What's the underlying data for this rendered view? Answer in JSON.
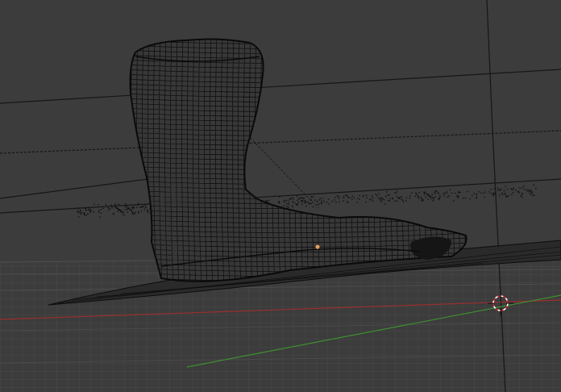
{
  "viewport": {
    "mode": "wireframe",
    "background_color": "#3c3c3c",
    "grid_color": "#4a4a4a",
    "x_axis_color": "#9b2f2f",
    "y_axis_color": "#3f8f2f",
    "wire_color": "#0c0c0c",
    "point_cloud_color": "#111111",
    "origin_color": "#e0a060"
  },
  "objects": {
    "boot_mesh": "boot-wireframe",
    "point_cloud": "scanned-point-cloud",
    "ground_plane": "ground-plane-mesh"
  },
  "cursor_3d": "3d-cursor-icon"
}
